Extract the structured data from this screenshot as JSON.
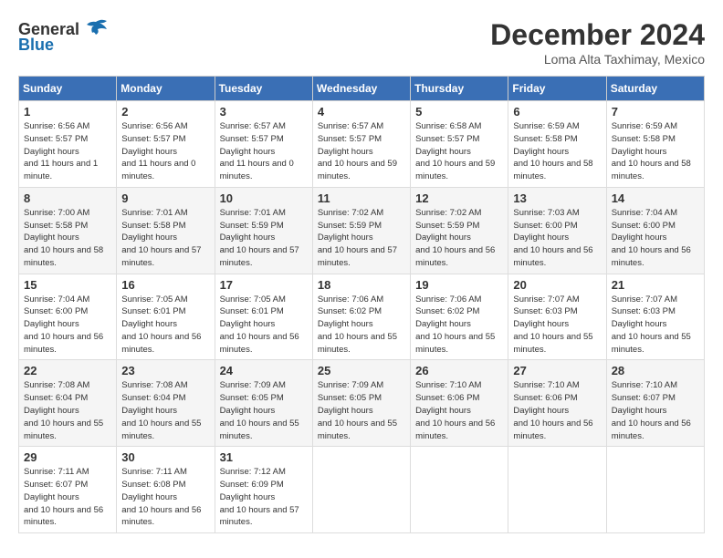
{
  "header": {
    "logo_general": "General",
    "logo_blue": "Blue",
    "month_title": "December 2024",
    "location": "Loma Alta Taxhimay, Mexico"
  },
  "days_of_week": [
    "Sunday",
    "Monday",
    "Tuesday",
    "Wednesday",
    "Thursday",
    "Friday",
    "Saturday"
  ],
  "weeks": [
    [
      {
        "day": "1",
        "sunrise": "6:56 AM",
        "sunset": "5:57 PM",
        "daylight": "11 hours and 1 minute."
      },
      {
        "day": "2",
        "sunrise": "6:56 AM",
        "sunset": "5:57 PM",
        "daylight": "11 hours and 0 minutes."
      },
      {
        "day": "3",
        "sunrise": "6:57 AM",
        "sunset": "5:57 PM",
        "daylight": "11 hours and 0 minutes."
      },
      {
        "day": "4",
        "sunrise": "6:57 AM",
        "sunset": "5:57 PM",
        "daylight": "10 hours and 59 minutes."
      },
      {
        "day": "5",
        "sunrise": "6:58 AM",
        "sunset": "5:57 PM",
        "daylight": "10 hours and 59 minutes."
      },
      {
        "day": "6",
        "sunrise": "6:59 AM",
        "sunset": "5:58 PM",
        "daylight": "10 hours and 58 minutes."
      },
      {
        "day": "7",
        "sunrise": "6:59 AM",
        "sunset": "5:58 PM",
        "daylight": "10 hours and 58 minutes."
      }
    ],
    [
      {
        "day": "8",
        "sunrise": "7:00 AM",
        "sunset": "5:58 PM",
        "daylight": "10 hours and 58 minutes."
      },
      {
        "day": "9",
        "sunrise": "7:01 AM",
        "sunset": "5:58 PM",
        "daylight": "10 hours and 57 minutes."
      },
      {
        "day": "10",
        "sunrise": "7:01 AM",
        "sunset": "5:59 PM",
        "daylight": "10 hours and 57 minutes."
      },
      {
        "day": "11",
        "sunrise": "7:02 AM",
        "sunset": "5:59 PM",
        "daylight": "10 hours and 57 minutes."
      },
      {
        "day": "12",
        "sunrise": "7:02 AM",
        "sunset": "5:59 PM",
        "daylight": "10 hours and 56 minutes."
      },
      {
        "day": "13",
        "sunrise": "7:03 AM",
        "sunset": "6:00 PM",
        "daylight": "10 hours and 56 minutes."
      },
      {
        "day": "14",
        "sunrise": "7:04 AM",
        "sunset": "6:00 PM",
        "daylight": "10 hours and 56 minutes."
      }
    ],
    [
      {
        "day": "15",
        "sunrise": "7:04 AM",
        "sunset": "6:00 PM",
        "daylight": "10 hours and 56 minutes."
      },
      {
        "day": "16",
        "sunrise": "7:05 AM",
        "sunset": "6:01 PM",
        "daylight": "10 hours and 56 minutes."
      },
      {
        "day": "17",
        "sunrise": "7:05 AM",
        "sunset": "6:01 PM",
        "daylight": "10 hours and 56 minutes."
      },
      {
        "day": "18",
        "sunrise": "7:06 AM",
        "sunset": "6:02 PM",
        "daylight": "10 hours and 55 minutes."
      },
      {
        "day": "19",
        "sunrise": "7:06 AM",
        "sunset": "6:02 PM",
        "daylight": "10 hours and 55 minutes."
      },
      {
        "day": "20",
        "sunrise": "7:07 AM",
        "sunset": "6:03 PM",
        "daylight": "10 hours and 55 minutes."
      },
      {
        "day": "21",
        "sunrise": "7:07 AM",
        "sunset": "6:03 PM",
        "daylight": "10 hours and 55 minutes."
      }
    ],
    [
      {
        "day": "22",
        "sunrise": "7:08 AM",
        "sunset": "6:04 PM",
        "daylight": "10 hours and 55 minutes."
      },
      {
        "day": "23",
        "sunrise": "7:08 AM",
        "sunset": "6:04 PM",
        "daylight": "10 hours and 55 minutes."
      },
      {
        "day": "24",
        "sunrise": "7:09 AM",
        "sunset": "6:05 PM",
        "daylight": "10 hours and 55 minutes."
      },
      {
        "day": "25",
        "sunrise": "7:09 AM",
        "sunset": "6:05 PM",
        "daylight": "10 hours and 55 minutes."
      },
      {
        "day": "26",
        "sunrise": "7:10 AM",
        "sunset": "6:06 PM",
        "daylight": "10 hours and 56 minutes."
      },
      {
        "day": "27",
        "sunrise": "7:10 AM",
        "sunset": "6:06 PM",
        "daylight": "10 hours and 56 minutes."
      },
      {
        "day": "28",
        "sunrise": "7:10 AM",
        "sunset": "6:07 PM",
        "daylight": "10 hours and 56 minutes."
      }
    ],
    [
      {
        "day": "29",
        "sunrise": "7:11 AM",
        "sunset": "6:07 PM",
        "daylight": "10 hours and 56 minutes."
      },
      {
        "day": "30",
        "sunrise": "7:11 AM",
        "sunset": "6:08 PM",
        "daylight": "10 hours and 56 minutes."
      },
      {
        "day": "31",
        "sunrise": "7:12 AM",
        "sunset": "6:09 PM",
        "daylight": "10 hours and 57 minutes."
      },
      null,
      null,
      null,
      null
    ]
  ]
}
